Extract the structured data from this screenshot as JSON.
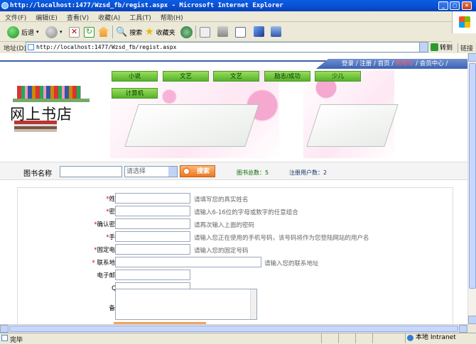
{
  "window": {
    "title": "http://localhost:1477/Wzsd_fb/regist.aspx - Microsoft Internet Explorer"
  },
  "menu": [
    "文件(F)",
    "编辑(E)",
    "查看(V)",
    "收藏(A)",
    "工具(T)",
    "帮助(H)"
  ],
  "toolbar": {
    "back": "后退",
    "search": "搜索",
    "favorites": "收藏夹"
  },
  "address": {
    "label": "地址(D)",
    "url": "http://localhost:1477/Wzsd_fb/regist.aspx",
    "go": "转到",
    "links": "链接"
  },
  "site": {
    "logo": "网上书店",
    "topnav": {
      "login": "登录",
      "register": "注册",
      "home": "首页",
      "cart": "购物车",
      "member": "会员中心"
    },
    "categories": [
      "小说",
      "文艺",
      "文艺",
      "励志/成功",
      "少儿",
      "计算机"
    ]
  },
  "search": {
    "label": "图书名称",
    "select": "请选择",
    "button": "搜索",
    "book_total": "图书总数：5",
    "user_total": "注册用户数：2"
  },
  "form": {
    "fields": [
      {
        "label": "姓名：",
        "required": true,
        "hint": "请填写您的真实姓名"
      },
      {
        "label": "密码：",
        "required": true,
        "hint": "请输入6-16位的字母或数字的任意组合"
      },
      {
        "label": "确认密码：",
        "required": true,
        "hint": "请再次输入上面的密码"
      },
      {
        "label": "手机：",
        "required": true,
        "hint": "请输入您正在使用的手机号码，该号码将作为您登陆网站的用户名"
      },
      {
        "label": "固定电话：",
        "required": true,
        "hint": "请输入您的固定号码"
      },
      {
        "label": "联系地址：",
        "required": true,
        "hint": "请输入您的联系地址"
      },
      {
        "label": "电子邮箱：",
        "required": false,
        "hint": ""
      },
      {
        "label": "QQ：",
        "required": false,
        "hint": ""
      },
      {
        "label": "备注：",
        "required": false,
        "hint": ""
      }
    ],
    "required_mark": "*"
  },
  "status": {
    "left": "完毕",
    "zone": "本地 Intranet"
  }
}
